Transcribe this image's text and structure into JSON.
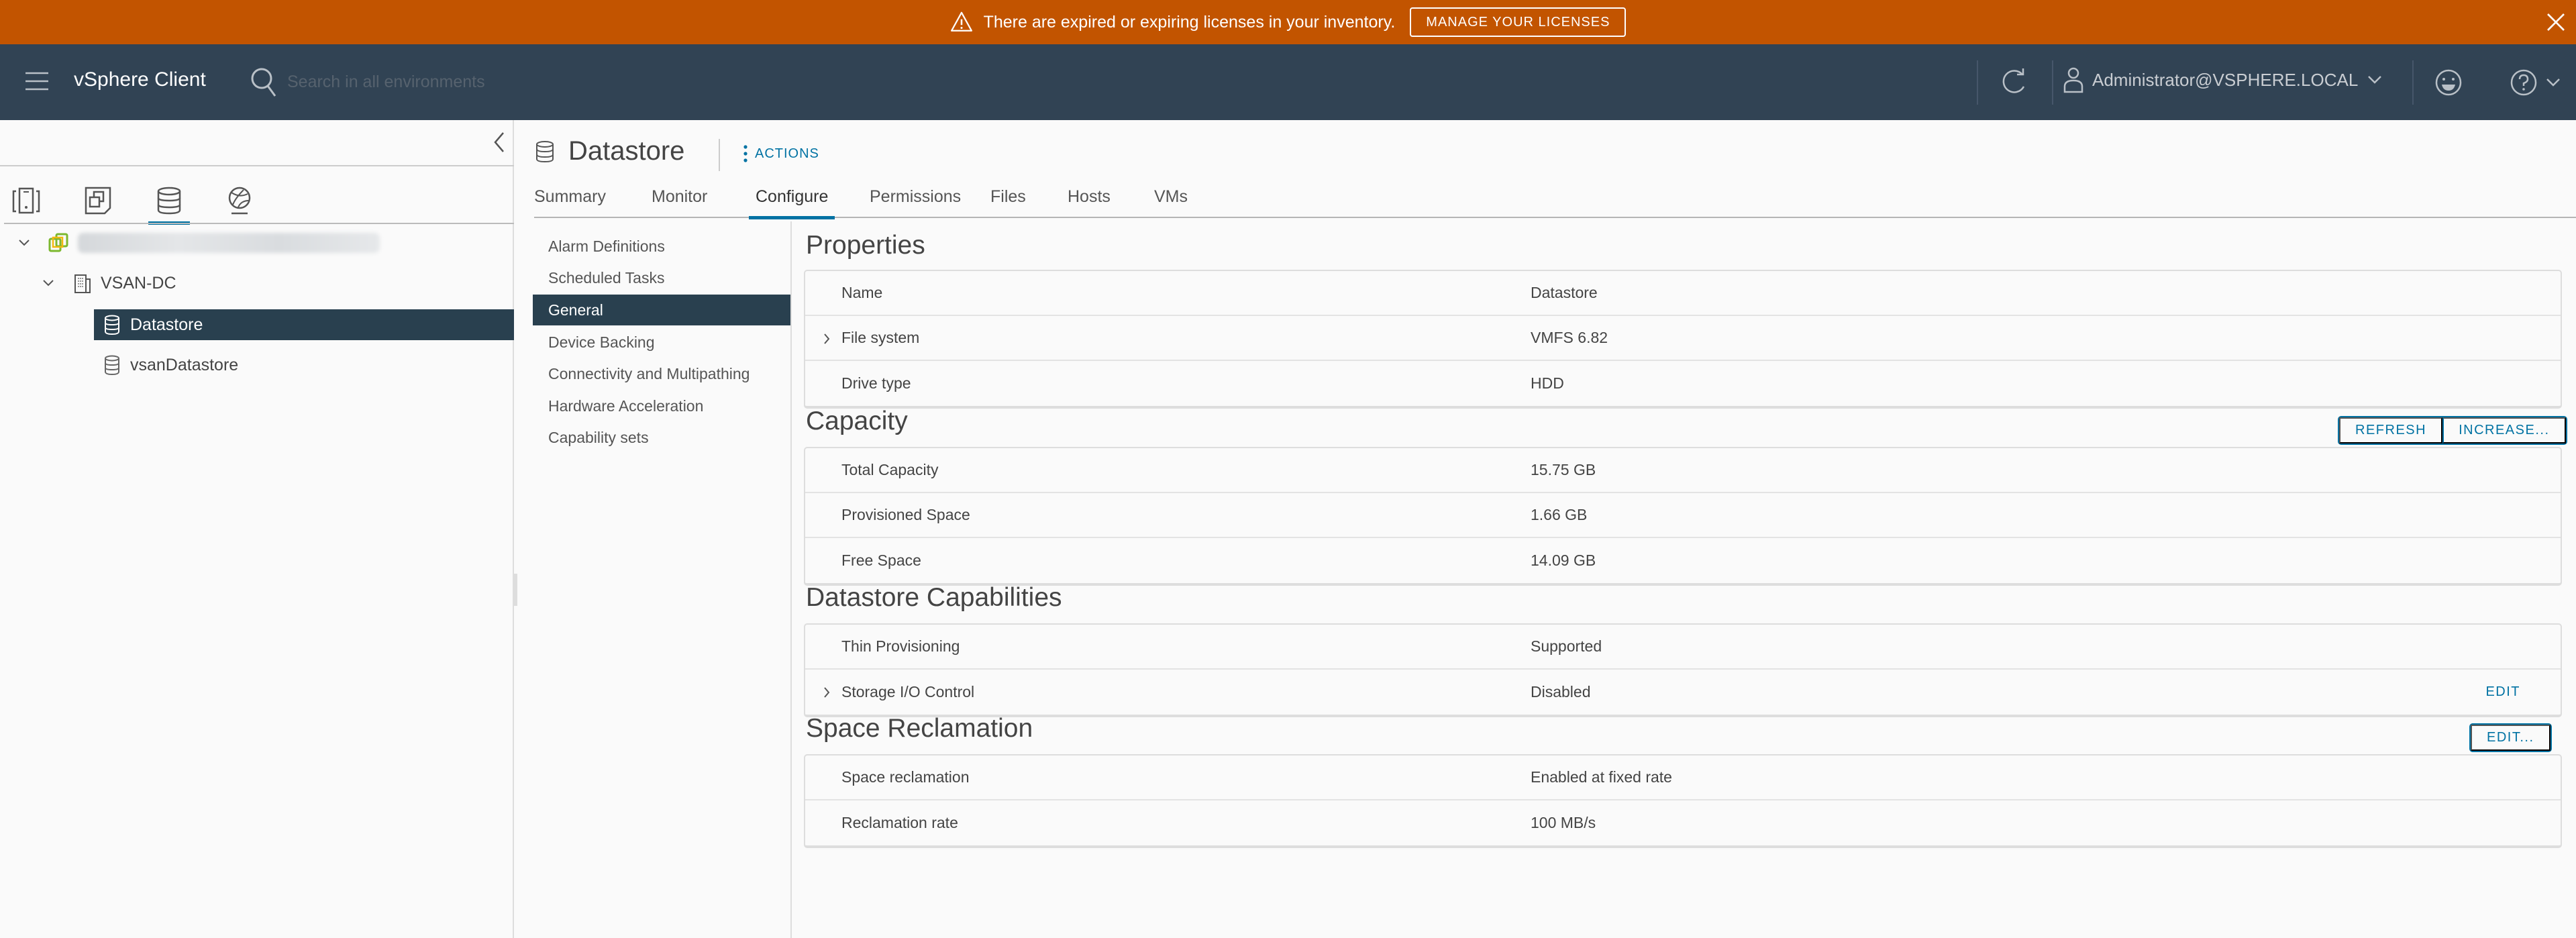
{
  "banner": {
    "message": "There are expired or expiring licenses in your inventory.",
    "button_label": "MANAGE YOUR LICENSES",
    "icon": "warning-icon",
    "close_icon": "close-icon",
    "color": "#c25400"
  },
  "header": {
    "app_title": "vSphere Client",
    "search_placeholder": "Search in all environments",
    "search_value": "",
    "user": "Administrator@VSPHERE.LOCAL",
    "icons": [
      "menu-icon",
      "search-icon",
      "refresh-icon",
      "user-icon",
      "feedback-smile-icon",
      "help-icon"
    ],
    "background": "#314354"
  },
  "navigator": {
    "tabs": [
      {
        "name": "hosts-and-clusters",
        "icon": "hosts-clusters-icon",
        "active": false
      },
      {
        "name": "vms-and-templates",
        "icon": "vms-templates-icon",
        "active": false
      },
      {
        "name": "storage",
        "icon": "storage-icon",
        "active": true
      },
      {
        "name": "networking",
        "icon": "networking-icon",
        "active": false
      }
    ],
    "tree": [
      {
        "label": "",
        "level": 0,
        "expanded": true,
        "icon": "vcenter-icon",
        "blurred": true
      },
      {
        "label": "VSAN-DC",
        "level": 1,
        "expanded": true,
        "icon": "datacenter-icon"
      },
      {
        "label": "Datastore",
        "level": 2,
        "icon": "datastore-icon",
        "selected": true
      },
      {
        "label": "vsanDatastore",
        "level": 2,
        "icon": "datastore-icon"
      }
    ]
  },
  "object": {
    "title": "Datastore",
    "actions_label": "ACTIONS",
    "tabs": [
      {
        "label": "Summary",
        "active": false
      },
      {
        "label": "Monitor",
        "active": false
      },
      {
        "label": "Configure",
        "active": true
      },
      {
        "label": "Permissions",
        "active": false
      },
      {
        "label": "Files",
        "active": false
      },
      {
        "label": "Hosts",
        "active": false
      },
      {
        "label": "VMs",
        "active": false
      }
    ]
  },
  "configure_nav": [
    {
      "label": "Alarm Definitions",
      "active": false
    },
    {
      "label": "Scheduled Tasks",
      "active": false
    },
    {
      "label": "General",
      "active": true
    },
    {
      "label": "Device Backing",
      "active": false
    },
    {
      "label": "Connectivity and Multipathing",
      "active": false
    },
    {
      "label": "Hardware Acceleration",
      "active": false
    },
    {
      "label": "Capability sets",
      "active": false
    }
  ],
  "sections": {
    "properties": {
      "title": "Properties",
      "rows": [
        {
          "label": "Name",
          "value": "Datastore",
          "expandable": false
        },
        {
          "label": "File system",
          "value": "VMFS 6.82",
          "expandable": true
        },
        {
          "label": "Drive type",
          "value": "HDD",
          "expandable": false
        }
      ]
    },
    "capacity": {
      "title": "Capacity",
      "refresh_label": "REFRESH",
      "increase_label": "INCREASE...",
      "rows": [
        {
          "label": "Total Capacity",
          "value": "15.75 GB"
        },
        {
          "label": "Provisioned Space",
          "value": "1.66 GB"
        },
        {
          "label": "Free Space",
          "value": "14.09 GB"
        }
      ]
    },
    "capabilities": {
      "title": "Datastore Capabilities",
      "rows": [
        {
          "label": "Thin Provisioning",
          "value": "Supported",
          "expandable": false
        },
        {
          "label": "Storage I/O Control",
          "value": "Disabled",
          "expandable": true,
          "edit_label": "EDIT"
        }
      ]
    },
    "reclamation": {
      "title": "Space Reclamation",
      "edit_label": "EDIT...",
      "rows": [
        {
          "label": "Space reclamation",
          "value": "Enabled at fixed rate"
        },
        {
          "label": "Reclamation rate",
          "value": "100 MB/s"
        }
      ]
    }
  },
  "colors": {
    "accent": "#0072a3",
    "selected_bg": "#29404f"
  }
}
